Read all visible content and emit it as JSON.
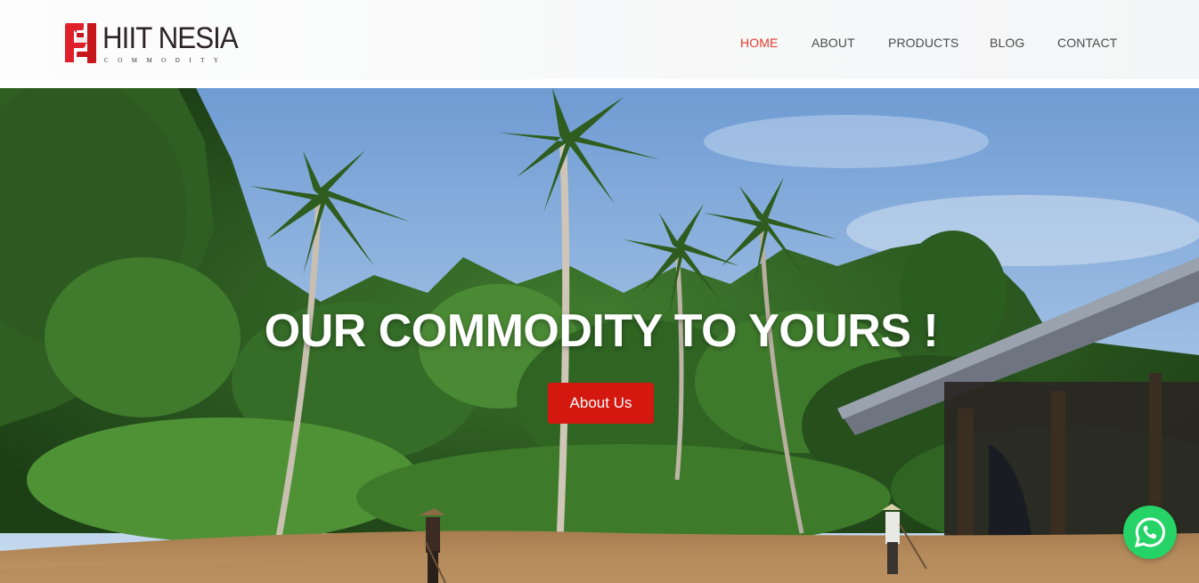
{
  "brand": {
    "name": "HIIT NESIA",
    "tagline": "COMMODITY",
    "logo_icon": "hiit-mark-logo",
    "accent_color": "#e23a2a"
  },
  "nav": {
    "items": [
      {
        "label": "HOME",
        "active": true
      },
      {
        "label": "ABOUT",
        "active": false
      },
      {
        "label": "PRODUCTS",
        "active": false
      },
      {
        "label": "BLOG",
        "active": false
      },
      {
        "label": "CONTACT",
        "active": false
      }
    ]
  },
  "hero": {
    "title": "OUR COMMODITY TO YOURS !",
    "button_label": "About Us",
    "button_color": "#d4170f",
    "background": "tropical-farm-palm-trees-photo"
  },
  "floating": {
    "whatsapp_icon": "whatsapp-icon",
    "color": "#25d366"
  }
}
